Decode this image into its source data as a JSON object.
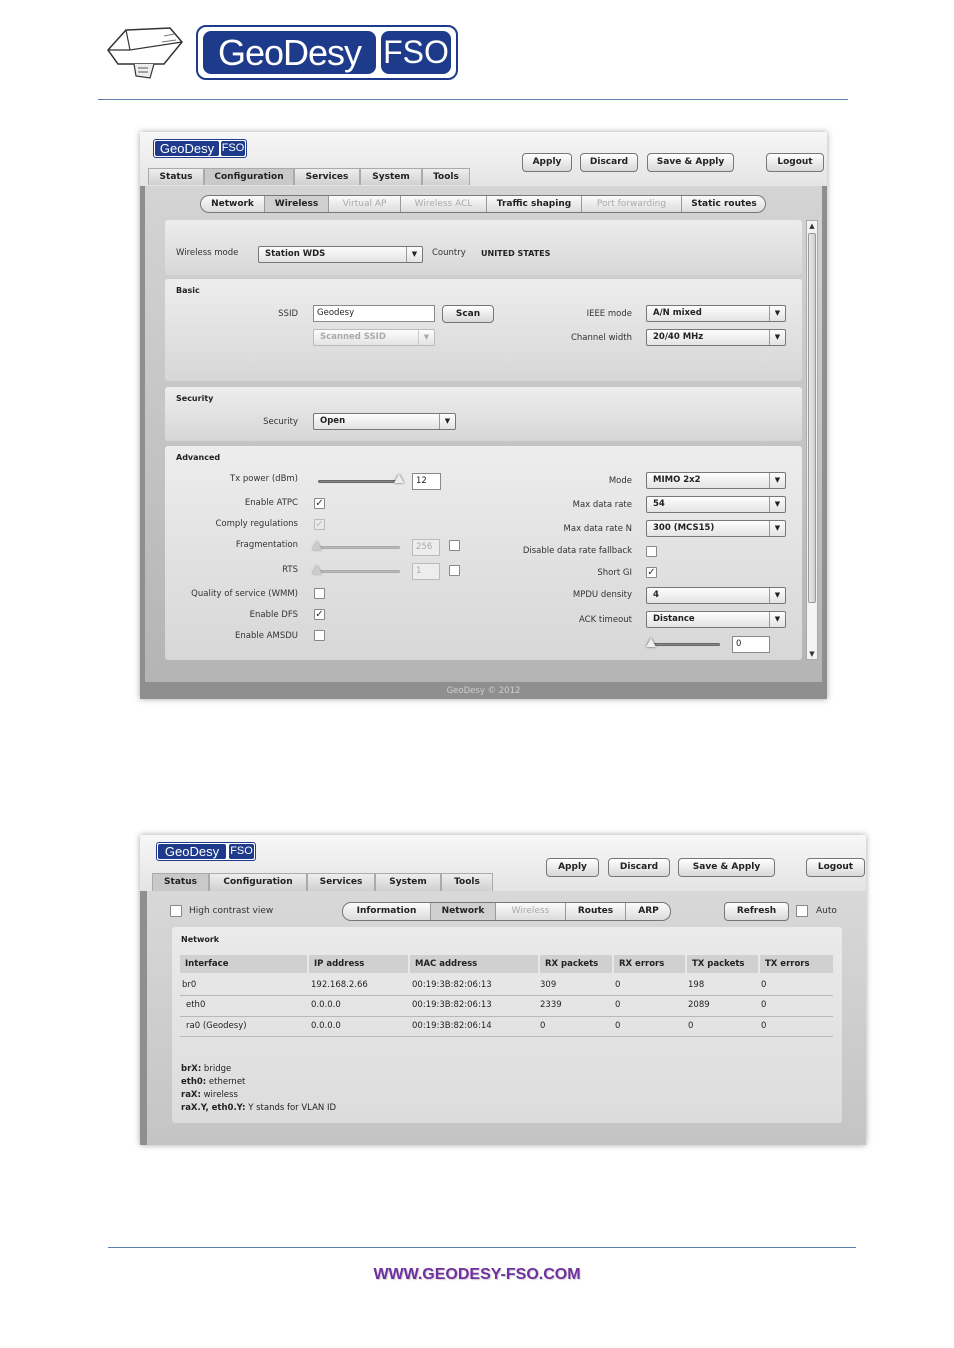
{
  "doc": {
    "brand_geo": "GeoDesy",
    "brand_fso": "FSO",
    "footer_url": "WWW.GEODESY-FSO.COM"
  },
  "screen1": {
    "logo_geo": "GeoDesy",
    "logo_fso": "FSO",
    "buttons": {
      "apply": "Apply",
      "discard": "Discard",
      "save_apply": "Save & Apply",
      "logout": "Logout"
    },
    "main_tabs": [
      "Status",
      "Configuration",
      "Services",
      "System",
      "Tools"
    ],
    "sub_tabs": [
      "Network",
      "Wireless",
      "Virtual AP",
      "Wireless ACL",
      "Traffic shaping",
      "Port forwarding",
      "Static routes"
    ],
    "wireless_mode_label": "Wireless mode",
    "wireless_mode_value": "Station WDS",
    "country_label": "Country",
    "country_value": "UNITED STATES",
    "basic": {
      "title": "Basic",
      "ssid_label": "SSID",
      "ssid_value": "Geodesy",
      "scan_button": "Scan",
      "scanned_ssid": "Scanned SSID",
      "ieee_label": "IEEE mode",
      "ieee_value": "A/N mixed",
      "channel_width_label": "Channel width",
      "channel_width_value": "20/40 MHz"
    },
    "security": {
      "title": "Security",
      "security_label": "Security",
      "security_value": "Open"
    },
    "advanced": {
      "title": "Advanced",
      "tx_power_label": "Tx power (dBm)",
      "tx_power_value": "12",
      "enable_atpc_label": "Enable ATPC",
      "comply_label": "Comply regulations",
      "fragmentation_label": "Fragmentation",
      "fragmentation_value": "256",
      "rts_label": "RTS",
      "rts_value": "1",
      "qos_label": "Quality of service (WMM)",
      "dfs_label": "Enable DFS",
      "amsdu_label": "Enable AMSDU",
      "mode_label": "Mode",
      "mode_value": "MIMO 2x2",
      "max_rate_label": "Max data rate",
      "max_rate_value": "54",
      "max_rate_n_label": "Max data rate N",
      "max_rate_n_value": "300 (MCS15)",
      "fallback_label": "Disable data rate fallback",
      "short_gi_label": "Short GI",
      "mpdu_label": "MPDU density",
      "mpdu_value": "4",
      "ack_label": "ACK timeout",
      "ack_value": "Distance",
      "ack_number": "0"
    },
    "footer": "GeoDesy © 2012"
  },
  "screen2": {
    "logo_geo": "GeoDesy",
    "logo_fso": "FSO",
    "buttons": {
      "apply": "Apply",
      "discard": "Discard",
      "save_apply": "Save & Apply",
      "logout": "Logout",
      "refresh": "Refresh"
    },
    "main_tabs": [
      "Status",
      "Configuration",
      "Services",
      "System",
      "Tools"
    ],
    "high_contrast_label": "High contrast view",
    "sub_tabs": [
      "Information",
      "Network",
      "Wireless",
      "Routes",
      "ARP"
    ],
    "auto_label": "Auto",
    "network": {
      "title": "Network",
      "columns": [
        "Interface",
        "IP address",
        "MAC address",
        "RX packets",
        "RX errors",
        "TX packets",
        "TX errors"
      ],
      "rows": [
        [
          "br0",
          "192.168.2.66",
          "00:19:3B:82:06:13",
          "309",
          "0",
          "198",
          "0"
        ],
        [
          " eth0",
          "0.0.0.0",
          "00:19:3B:82:06:13",
          "2339",
          "0",
          "2089",
          "0"
        ],
        [
          " ra0 (Geodesy)",
          "0.0.0.0",
          "00:19:3B:82:06:14",
          "0",
          "0",
          "0",
          "0"
        ]
      ]
    },
    "legend": [
      {
        "key": "brX:",
        "text": " bridge"
      },
      {
        "key": "eth0:",
        "text": " ethernet"
      },
      {
        "key": "raX:",
        "text": " wireless"
      },
      {
        "key": "raX.Y, eth0.Y:",
        "text": " Y stands for VLAN ID"
      }
    ]
  }
}
